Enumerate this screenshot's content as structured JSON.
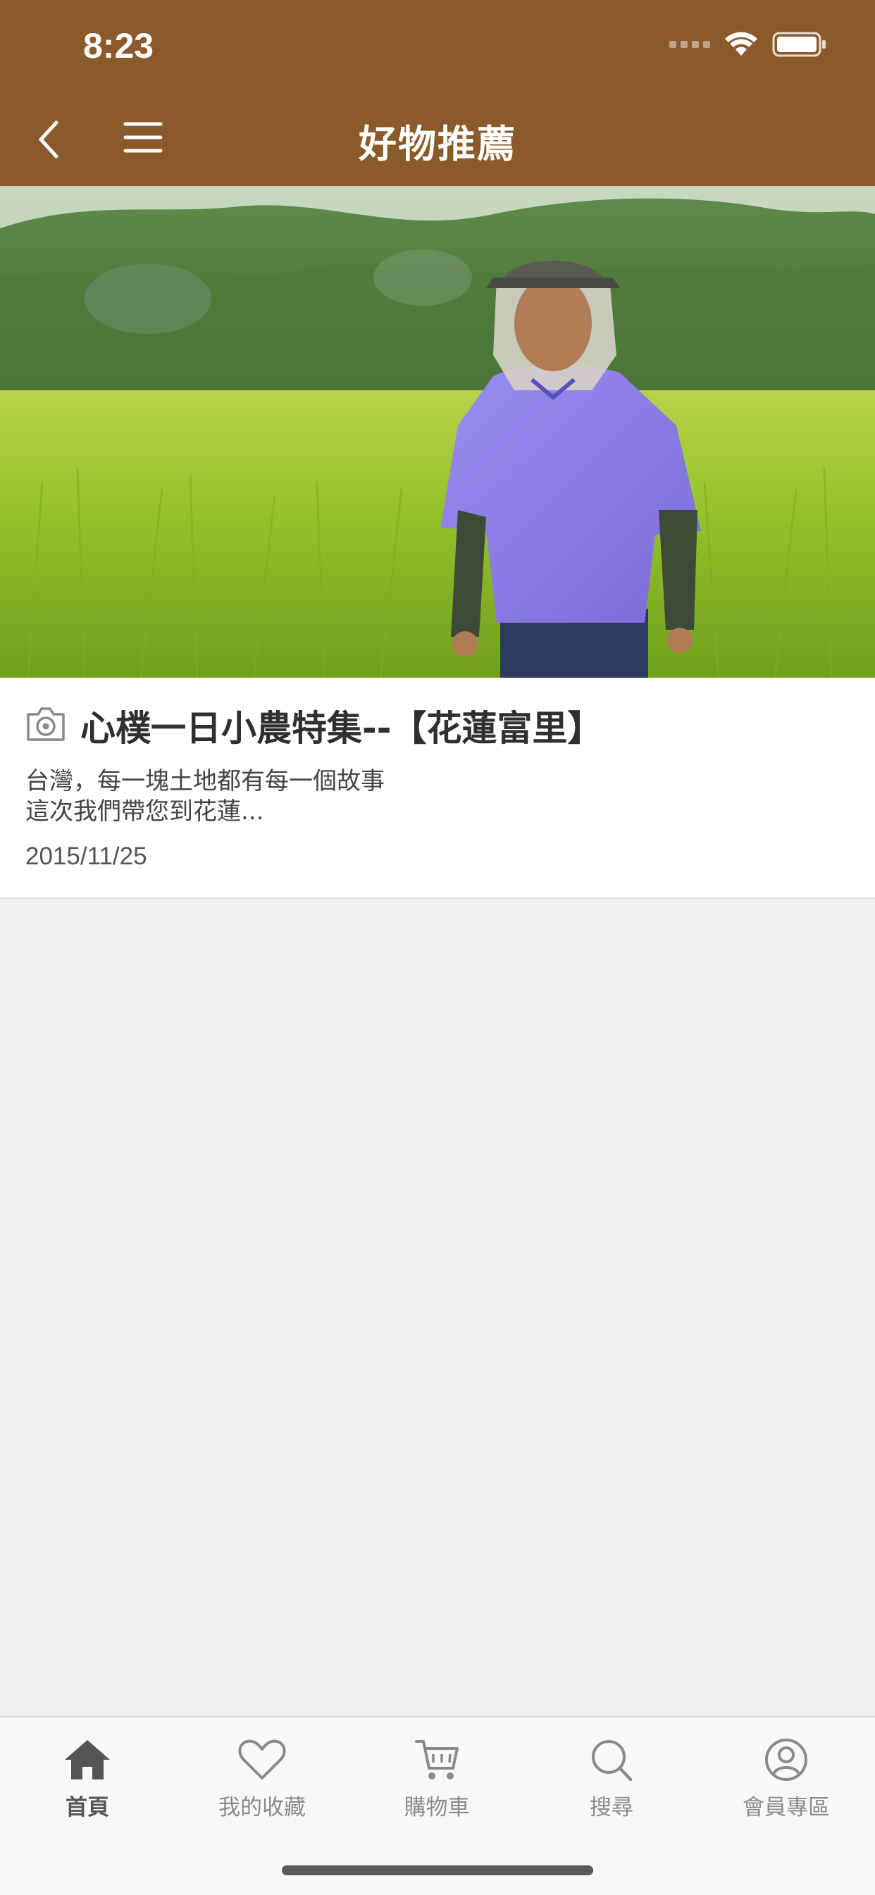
{
  "status_bar": {
    "time": "8:23"
  },
  "nav": {
    "title": "好物推薦"
  },
  "article": {
    "title": "心樸一日小農特集--【花蓮富里】",
    "desc_line1": "台灣，每一塊土地都有每一個故事",
    "desc_line2": "這次我們帶您到花蓮...",
    "date": "2015/11/25"
  },
  "tabs": [
    {
      "label": "首頁",
      "icon": "home-icon",
      "active": true
    },
    {
      "label": "我的收藏",
      "icon": "heart-icon",
      "active": false
    },
    {
      "label": "購物車",
      "icon": "cart-icon",
      "active": false
    },
    {
      "label": "搜尋",
      "icon": "search-icon",
      "active": false
    },
    {
      "label": "會員專區",
      "icon": "user-icon",
      "active": false
    }
  ],
  "colors": {
    "header_brown": "#8a5a2b",
    "tab_active": "#555555",
    "tab_inactive": "#8a8a8a"
  }
}
